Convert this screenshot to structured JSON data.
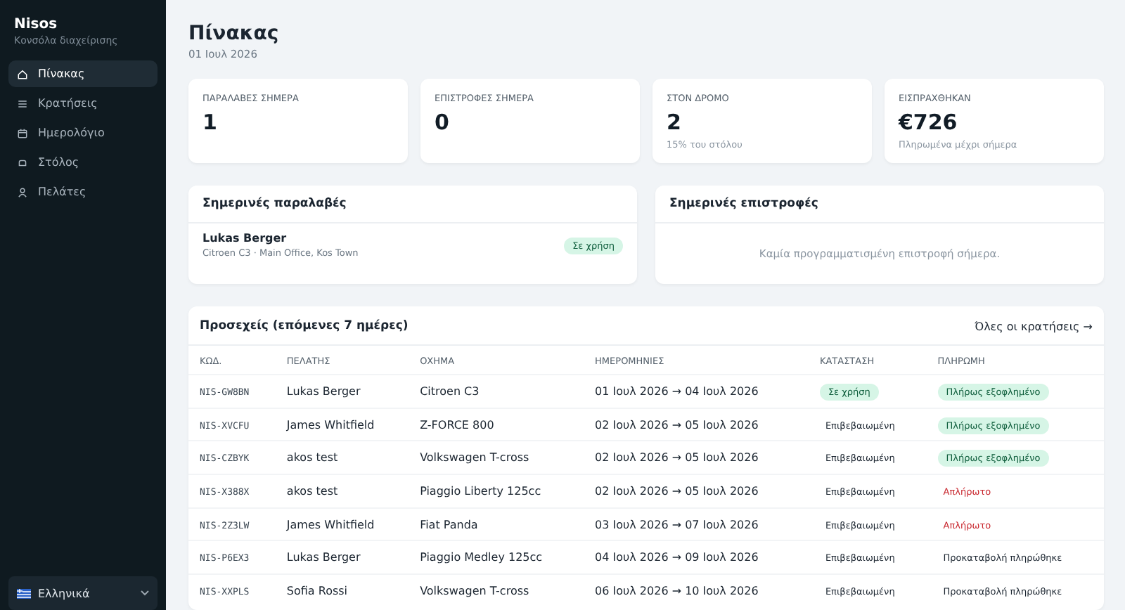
{
  "sidebar": {
    "brand": "Nisos",
    "subtitle": "Κονσόλα διαχείρισης",
    "items": [
      {
        "kind": "home",
        "label": "Πίνακας",
        "selected": true
      },
      {
        "kind": "list",
        "label": "Κρατήσεις",
        "selected": false
      },
      {
        "kind": "calendar",
        "label": "Ημερολόγιο",
        "selected": false
      },
      {
        "kind": "car",
        "label": "Στόλος",
        "selected": false
      },
      {
        "kind": "user",
        "label": "Πελάτες",
        "selected": false
      }
    ],
    "language": "Ελληνικά"
  },
  "page": {
    "title": "Πίνακας",
    "date": "01 Ιουλ 2026"
  },
  "stats": [
    {
      "label": "ΠΑΡΑΛΑΒΕΣ ΣΗΜΕΡΑ",
      "value": "1"
    },
    {
      "label": "ΕΠΙΣΤΡΟΦΕΣ ΣΗΜΕΡΑ",
      "value": "0"
    },
    {
      "label": "ΣΤΟΝ ΔΡΟΜΟ",
      "value": "2",
      "note": "15% του στόλου"
    },
    {
      "label": "ΕΙΣΠΡΑΧΘΗΚΑΝ",
      "value": "€726",
      "note": "Πληρωμένα μέχρι σήμερα"
    }
  ],
  "pickups": {
    "title": "Σημερινές παραλαβές",
    "items": [
      {
        "name": "Lukas Berger",
        "detail": "Citroen C3 · Main Office, Kos Town",
        "status": "Σε χρήση"
      }
    ]
  },
  "returns": {
    "title": "Σημερινές επιστροφές",
    "empty": "Καμία προγραμματισμένη επιστροφή σήμερα."
  },
  "upcoming": {
    "title": "Προσεχείς (επόμενες 7 ημέρες)",
    "link": "Όλες οι κρατήσεις →",
    "columns": [
      "ΚΩΔ.",
      "ΠΕΛΑΤΗΣ",
      "ΟΧΗΜΑ",
      "ΗΜΕΡΟΜΗΝΙΕΣ",
      "ΚΑΤΑΣΤΑΣΗ",
      "ΠΛΗΡΩΜΗ"
    ],
    "rows": [
      {
        "code": "NIS-GW8BN",
        "customer": "Lukas Berger",
        "vehicle": "Citroen C3",
        "dates": "01 Ιουλ 2026 → 04 Ιουλ 2026",
        "status": {
          "kind": "in_use",
          "label": "Σε χρήση"
        },
        "payment": {
          "kind": "paid",
          "label": "Πλήρως εξοφλημένο"
        }
      },
      {
        "code": "NIS-XVCFU",
        "customer": "James Whitfield",
        "vehicle": "Z-FORCE 800",
        "dates": "02 Ιουλ 2026 → 05 Ιουλ 2026",
        "status": {
          "kind": "confirmed",
          "label": "Επιβεβαιωμένη"
        },
        "payment": {
          "kind": "paid",
          "label": "Πλήρως εξοφλημένο"
        }
      },
      {
        "code": "NIS-CZBYK",
        "customer": "akos test",
        "vehicle": "Volkswagen T-cross",
        "dates": "02 Ιουλ 2026 → 05 Ιουλ 2026",
        "status": {
          "kind": "confirmed",
          "label": "Επιβεβαιωμένη"
        },
        "payment": {
          "kind": "paid",
          "label": "Πλήρως εξοφλημένο"
        }
      },
      {
        "code": "NIS-X388X",
        "customer": "akos test",
        "vehicle": "Piaggio Liberty 125cc",
        "dates": "02 Ιουλ 2026 → 05 Ιουλ 2026",
        "status": {
          "kind": "confirmed",
          "label": "Επιβεβαιωμένη"
        },
        "payment": {
          "kind": "unpaid",
          "label": "Απλήρωτο"
        }
      },
      {
        "code": "NIS-2Z3LW",
        "customer": "James Whitfield",
        "vehicle": "Fiat Panda",
        "dates": "03 Ιουλ 2026 → 07 Ιουλ 2026",
        "status": {
          "kind": "confirmed",
          "label": "Επιβεβαιωμένη"
        },
        "payment": {
          "kind": "unpaid",
          "label": "Απλήρωτο"
        }
      },
      {
        "code": "NIS-P6EX3",
        "customer": "Lukas Berger",
        "vehicle": "Piaggio Medley 125cc",
        "dates": "04 Ιουλ 2026 → 09 Ιουλ 2026",
        "status": {
          "kind": "confirmed",
          "label": "Επιβεβαιωμένη"
        },
        "payment": {
          "kind": "deposit",
          "label": "Προκαταβολή πληρώθηκε"
        }
      },
      {
        "code": "NIS-XXPLS",
        "customer": "Sofia Rossi",
        "vehicle": "Volkswagen T-cross",
        "dates": "06 Ιουλ 2026 → 10 Ιουλ 2026",
        "status": {
          "kind": "confirmed",
          "label": "Επιβεβαιωμένη"
        },
        "payment": {
          "kind": "deposit",
          "label": "Προκαταβολή πληρώθηκε"
        }
      }
    ]
  }
}
